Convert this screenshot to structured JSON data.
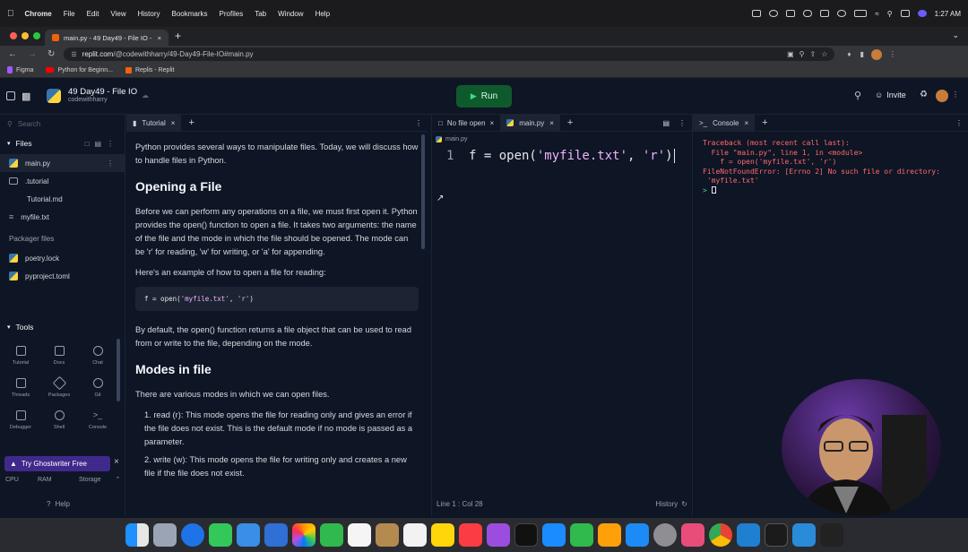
{
  "menubar": {
    "app": "Chrome",
    "items": [
      "File",
      "Edit",
      "View",
      "History",
      "Bookmarks",
      "Profiles",
      "Tab",
      "Window",
      "Help"
    ],
    "time": "1:27 AM"
  },
  "browser": {
    "tab_title": "main.py - 49 Day49 - File IO -",
    "url_host": "replit.com",
    "url_path": "/@codewithharry/49-Day49-File-IO#main.py",
    "bookmarks": [
      "Figma",
      "Python for Beginn...",
      "Replis - Replit"
    ]
  },
  "header": {
    "project": "49 Day49 - File IO",
    "owner": "codewithharry",
    "run_label": "Run",
    "invite_label": "Invite"
  },
  "sidebar": {
    "search_placeholder": "Search",
    "files_label": "Files",
    "files": [
      {
        "name": "main.py",
        "type": "python",
        "indent": 0
      },
      {
        "name": ".tutorial",
        "type": "folder",
        "indent": 0
      },
      {
        "name": "Tutorial.md",
        "type": "md",
        "indent": 1
      },
      {
        "name": "myfile.txt",
        "type": "txt",
        "indent": 0
      }
    ],
    "packager_label": "Packager files",
    "packager": [
      "poetry.lock",
      "pyproject.toml"
    ],
    "tools_label": "Tools",
    "tools": [
      "Tutorial",
      "Docs",
      "Chat",
      "Threads",
      "Packages",
      "Git",
      "Debugger",
      "Shell",
      "Console"
    ],
    "ghostwriter": "Try Ghostwriter Free",
    "resources": [
      "CPU",
      "RAM",
      "Storage"
    ],
    "help": "Help"
  },
  "tutorial": {
    "tab": "Tutorial",
    "intro": "Python provides several ways to manipulate files. Today, we will discuss how to handle files in Python.",
    "h1": "Opening a File",
    "p1": "Before we can perform any operations on a file, we must first open it. Python provides the open() function to open a file. It takes two arguments: the name of the file and the mode in which the file should be opened. The mode can be 'r' for reading, 'w' for writing, or 'a' for appending.",
    "p2": "Here's an example of how to open a file for reading:",
    "code_pre": "f = open(",
    "code_s1": "'myfile.txt'",
    "code_mid": ", ",
    "code_s2": "'r'",
    "code_post": ")",
    "p3": "By default, the open() function returns a file object that can be used to read from or write to the file, depending on the mode.",
    "h2": "Modes in file",
    "p4": "There are various modes in which we can open files.",
    "li1": "1. read (r): This mode opens the file for reading only and gives an error if the file does not exist. This is the default mode if no mode is passed as a parameter.",
    "li2": "2. write (w): This mode opens the file for writing only and creates a new file if the file does not exist."
  },
  "editor": {
    "tab_nofile": "No file open",
    "tab_main": "main.py",
    "breadcrumb": "main.py",
    "line_no": "1",
    "code_pre": "f = open(",
    "code_s1": "'myfile.txt'",
    "code_mid": ", ",
    "code_s2": "'r'",
    "code_post": ")",
    "status": "Line 1 : Col 28",
    "history": "History"
  },
  "console": {
    "tab": "Console",
    "output": "Traceback (most recent call last):\n  File \"main.py\", line 1, in <module>\n    f = open('myfile.txt', 'r')\nFileNotFoundError: [Errno 2] No such file or directory:\n 'myfile.txt'",
    "prompt": ">"
  },
  "colors": {
    "bg": "#0e1525",
    "panel": "#1c2333",
    "run": "#0f5a2c",
    "error": "#ff6b6b",
    "accent": "#0079f2"
  }
}
